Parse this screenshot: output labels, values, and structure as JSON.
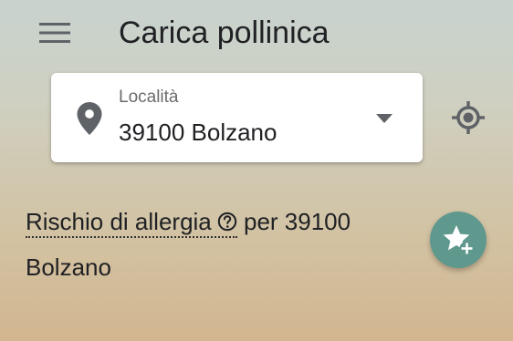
{
  "app_bar": {
    "menu_icon": "hamburger-menu-icon",
    "title": "Carica pollinica"
  },
  "location": {
    "label": "Località",
    "value": "39100 Bolzano",
    "pin_icon": "location-pin-icon",
    "dropdown_icon": "dropdown-arrow-icon"
  },
  "gps": {
    "icon": "my-location-icon"
  },
  "risk": {
    "link_text": "Rischio di allergia",
    "help_icon": "help-circle-icon",
    "suffix": " per 39100 Bolzano"
  },
  "fab": {
    "icon": "star-add-icon",
    "color": "#5f988d"
  },
  "colors": {
    "background_top": "#c8d3cf",
    "background_bottom": "#d2b68f",
    "icon_gray": "#5f6368"
  }
}
